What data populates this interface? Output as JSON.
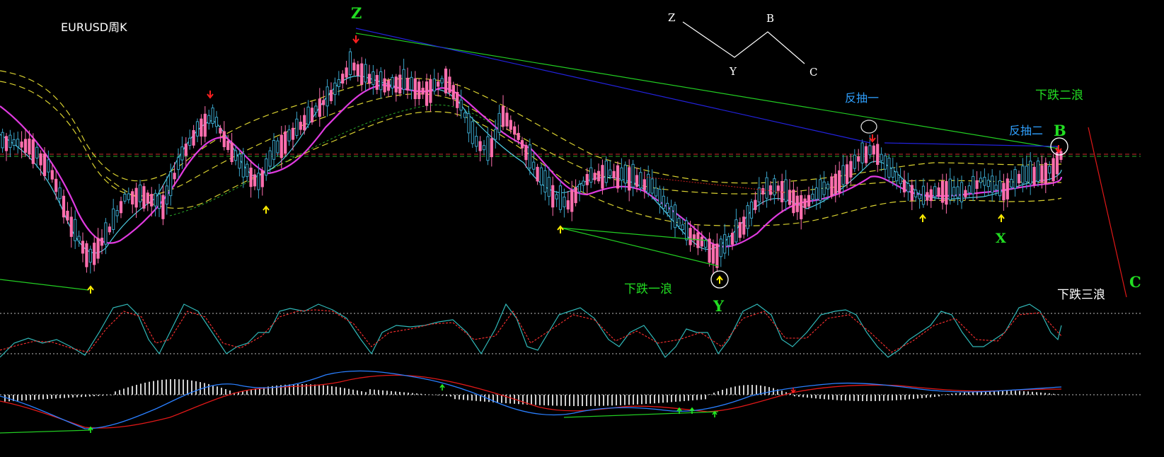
{
  "chart_data": {
    "type": "candlestick",
    "title": "EURUSD周K",
    "colors": {
      "up_candle": "#3aa3c8",
      "down_candle": "#ff6fae",
      "ma_fast": "#4fd0e6",
      "ma_mid": "#e03ae0",
      "bands": "#d8d030",
      "stoch_k": "#30b7b7",
      "stoch_d": "#ff3030",
      "macd_dif": "#2a7fff",
      "macd_dea": "#e01818",
      "histogram": "#d0d0d0",
      "trend_green": "#22cc22",
      "trend_blue": "#2222dd",
      "wave_C": "#e01818",
      "arrow_down": "#ff2020",
      "arrow_up": "#ffee00",
      "label_green": "#22dd22",
      "label_blue": "#2fa0ff",
      "label_white": "#ffffff"
    },
    "wave_labels": {
      "Z": "Z",
      "Y": "Y",
      "X": "X",
      "B": "B",
      "C": "C"
    },
    "legend_diagram": {
      "z": "Z",
      "y": "Y",
      "b": "B",
      "c": "C"
    },
    "annotations": {
      "down_wave_1": "下跌一浪",
      "down_wave_2": "下跌二浪",
      "down_wave_3": "下跌三浪",
      "rebound_1": "反抽一",
      "rebound_2": "反抽二"
    }
  }
}
